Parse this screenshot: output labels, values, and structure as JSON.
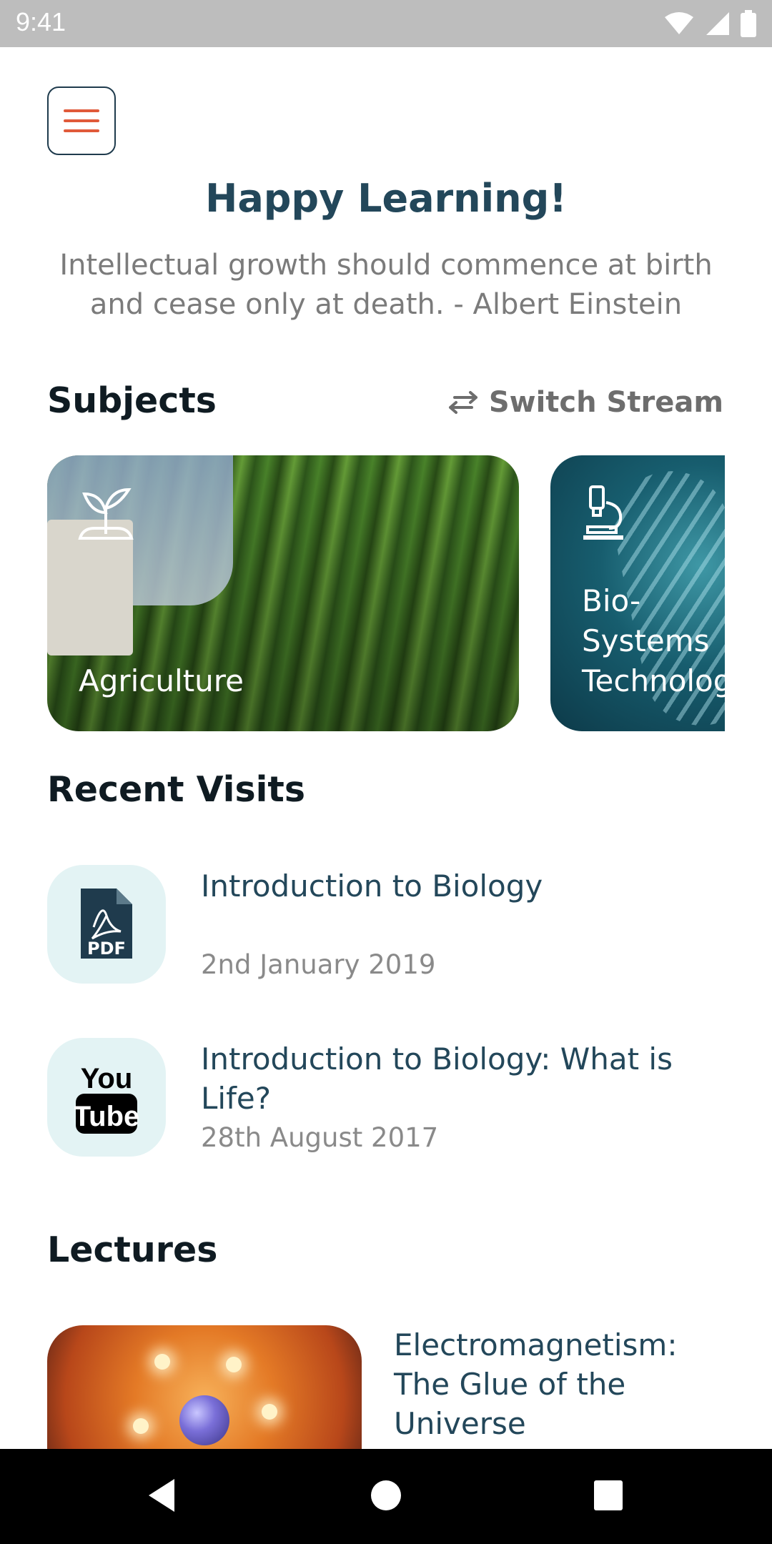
{
  "status_bar": {
    "time": "9:41",
    "icons": [
      "wifi-icon",
      "signal-icon",
      "battery-icon"
    ]
  },
  "header": {
    "menu_icon": "hamburger-menu-icon",
    "greeting": "Happy Learning!",
    "quote": "Intellectual growth should commence at birth and cease only at death. - Albert Einstein"
  },
  "subjects": {
    "title": "Subjects",
    "switch_label": "Switch Stream",
    "switch_icon": "swap-arrows-icon",
    "items": [
      {
        "name": "Agriculture",
        "icon": "sprout-icon"
      },
      {
        "name": "Bio-Systems\nTechnology",
        "icon": "microscope-icon"
      }
    ]
  },
  "recent_visits": {
    "title": "Recent Visits",
    "items": [
      {
        "title": "Introduction to Biology",
        "date": "2nd January 2019",
        "icon": "pdf-icon"
      },
      {
        "title": "Introduction to Biology: What is Life?",
        "date": "28th August 2017",
        "icon": "youtube-icon"
      }
    ]
  },
  "lectures": {
    "title": "Lectures",
    "items": [
      {
        "title": "Electromagnetism: The Glue of the Universe"
      }
    ]
  },
  "colors": {
    "accent": "#e05a3a",
    "primary_text": "#23475a",
    "muted_text": "#7b7b7b",
    "thumb_bg": "#e3f3f4"
  },
  "nav_bar": {
    "buttons": [
      "back-icon",
      "home-icon",
      "recents-icon"
    ]
  }
}
